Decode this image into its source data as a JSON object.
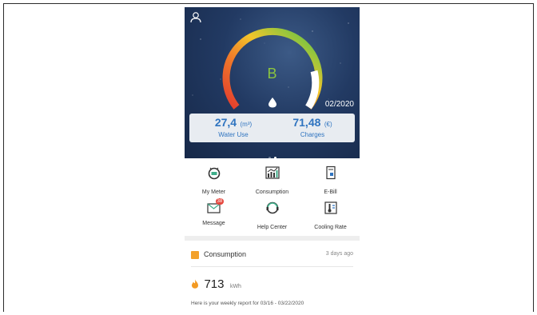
{
  "hero": {
    "grade": "B",
    "period": "02/2020",
    "water": {
      "value": "27,4",
      "unit": "(m³)",
      "label": "Water Use"
    },
    "charges": {
      "value": "71,48",
      "unit": "(€)",
      "label": "Charges"
    },
    "page_indicator": {
      "count": 2,
      "active": 1
    }
  },
  "menu": [
    {
      "label": "My Meter",
      "icon": "meter-icon"
    },
    {
      "label": "Consumption",
      "icon": "chart-icon"
    },
    {
      "label": "E-Bill",
      "icon": "bill-icon"
    },
    {
      "label": "Message",
      "icon": "mail-icon",
      "badge": "38"
    },
    {
      "label": "Help Center",
      "icon": "support-icon"
    },
    {
      "label": "Cooling Rate",
      "icon": "thermometer-icon"
    }
  ],
  "consumption_panel": {
    "title": "Consumption",
    "time": "3 days ago",
    "value": "713",
    "unit": "kWh",
    "note": "Here is your weekly report for 03/16 - 03/22/2020"
  },
  "colors": {
    "accent": "#2f74c0",
    "gauge_green": "#8bc53f",
    "badge": "#e5463d",
    "panel_icon": "#f3a12b"
  }
}
